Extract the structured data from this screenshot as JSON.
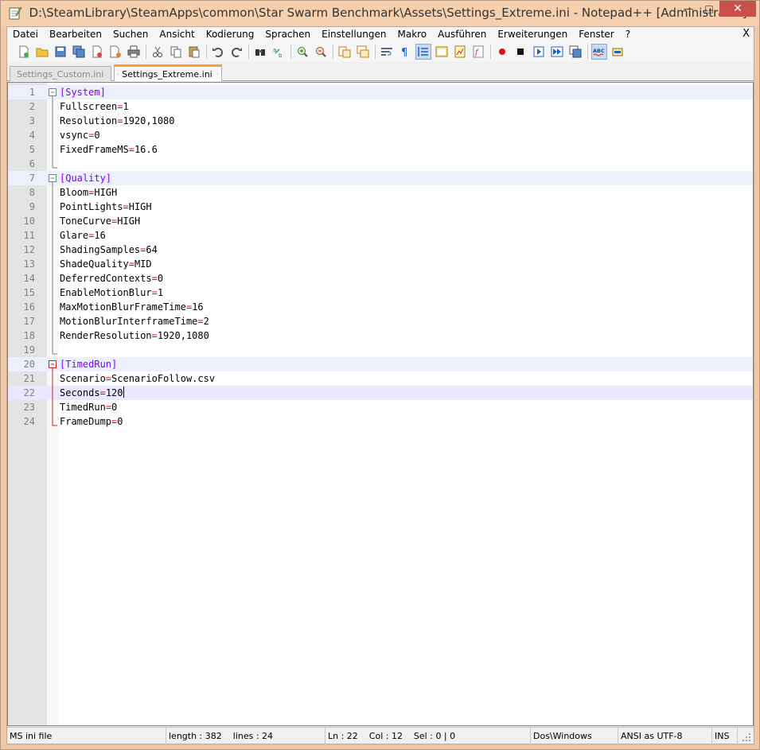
{
  "window": {
    "title": "D:\\SteamLibrary\\SteamApps\\common\\Star Swarm Benchmark\\Assets\\Settings_Extreme.ini - Notepad++ [Administrator]",
    "minimize_glyph": "—",
    "maximize_glyph": "□",
    "close_glyph": "✕"
  },
  "menu": {
    "items": [
      "Datei",
      "Bearbeiten",
      "Suchen",
      "Ansicht",
      "Kodierung",
      "Sprachen",
      "Einstellungen",
      "Makro",
      "Ausführen",
      "Erweiterungen",
      "Fenster",
      "?"
    ],
    "close_label": "X"
  },
  "tabs": [
    {
      "label": "Settings_Custom.ini",
      "active": false
    },
    {
      "label": "Settings_Extreme.ini",
      "active": true
    }
  ],
  "editor": {
    "lines": [
      {
        "n": "1",
        "section": "[System]"
      },
      {
        "n": "2",
        "key": "Fullscreen",
        "value": "1"
      },
      {
        "n": "3",
        "key": "Resolution",
        "value": "1920,1080"
      },
      {
        "n": "4",
        "key": "vsync",
        "value": "0"
      },
      {
        "n": "5",
        "key": "FixedFrameMS",
        "value": "16.6"
      },
      {
        "n": "6"
      },
      {
        "n": "7",
        "section": "[Quality]"
      },
      {
        "n": "8",
        "key": "Bloom",
        "value": "HIGH"
      },
      {
        "n": "9",
        "key": "PointLights",
        "value": "HIGH"
      },
      {
        "n": "10",
        "key": "ToneCurve",
        "value": "HIGH"
      },
      {
        "n": "11",
        "key": "Glare",
        "value": "16"
      },
      {
        "n": "12",
        "key": "ShadingSamples",
        "value": "64"
      },
      {
        "n": "13",
        "key": "ShadeQuality",
        "value": "MID"
      },
      {
        "n": "14",
        "key": "DeferredContexts",
        "value": "0"
      },
      {
        "n": "15",
        "key": "EnableMotionBlur",
        "value": "1"
      },
      {
        "n": "16",
        "key": "MaxMotionBlurFrameTime",
        "value": "16"
      },
      {
        "n": "17",
        "key": "MotionBlurInterframeTime",
        "value": "2"
      },
      {
        "n": "18",
        "key": "RenderResolution",
        "value": "1920,1080"
      },
      {
        "n": "19"
      },
      {
        "n": "20",
        "section": "[TimedRun]"
      },
      {
        "n": "21",
        "key": "Scenario",
        "value": "ScenarioFollow.csv"
      },
      {
        "n": "22",
        "key": "Seconds",
        "value": "120",
        "current": true
      },
      {
        "n": "23",
        "key": "TimedRun",
        "value": "0"
      },
      {
        "n": "24",
        "key": "FrameDump",
        "value": "0"
      }
    ]
  },
  "status": {
    "file_type": "MS ini file",
    "length_lines": "length : 382    lines : 24",
    "position": "Ln : 22    Col : 12    Sel : 0 | 0",
    "eol": "Dos\\Windows",
    "encoding": "ANSI as UTF-8",
    "mode": "INS"
  },
  "colors": {
    "section": "#8000ff",
    "operator": "#ff0000",
    "current_line": "#e8e8ff",
    "section_line": "#ebf0fb",
    "tab_accent": "#f9a030"
  }
}
